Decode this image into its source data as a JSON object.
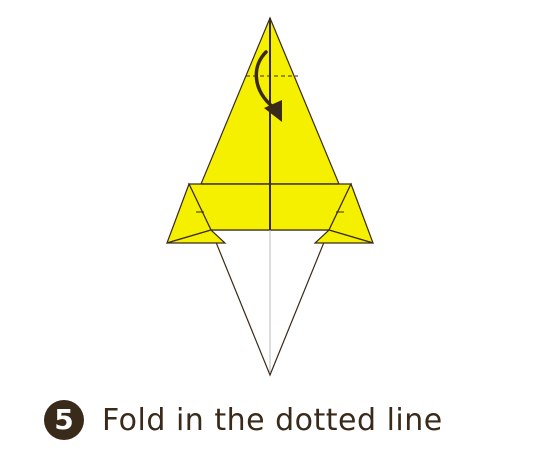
{
  "instruction": {
    "step_number": "5",
    "text": "Fold in the dotted line"
  },
  "colors": {
    "paper_front": "#f5f000",
    "paper_back": "#ffffff",
    "outline": "#3a2a1a",
    "badge": "#3a2a1a",
    "arrow": "#3a2a1a",
    "guide": "#bbbbbb"
  },
  "icons": {
    "fold_arrow": "curved-arrow-down-icon",
    "fold_line": "dotted-line-icon"
  }
}
